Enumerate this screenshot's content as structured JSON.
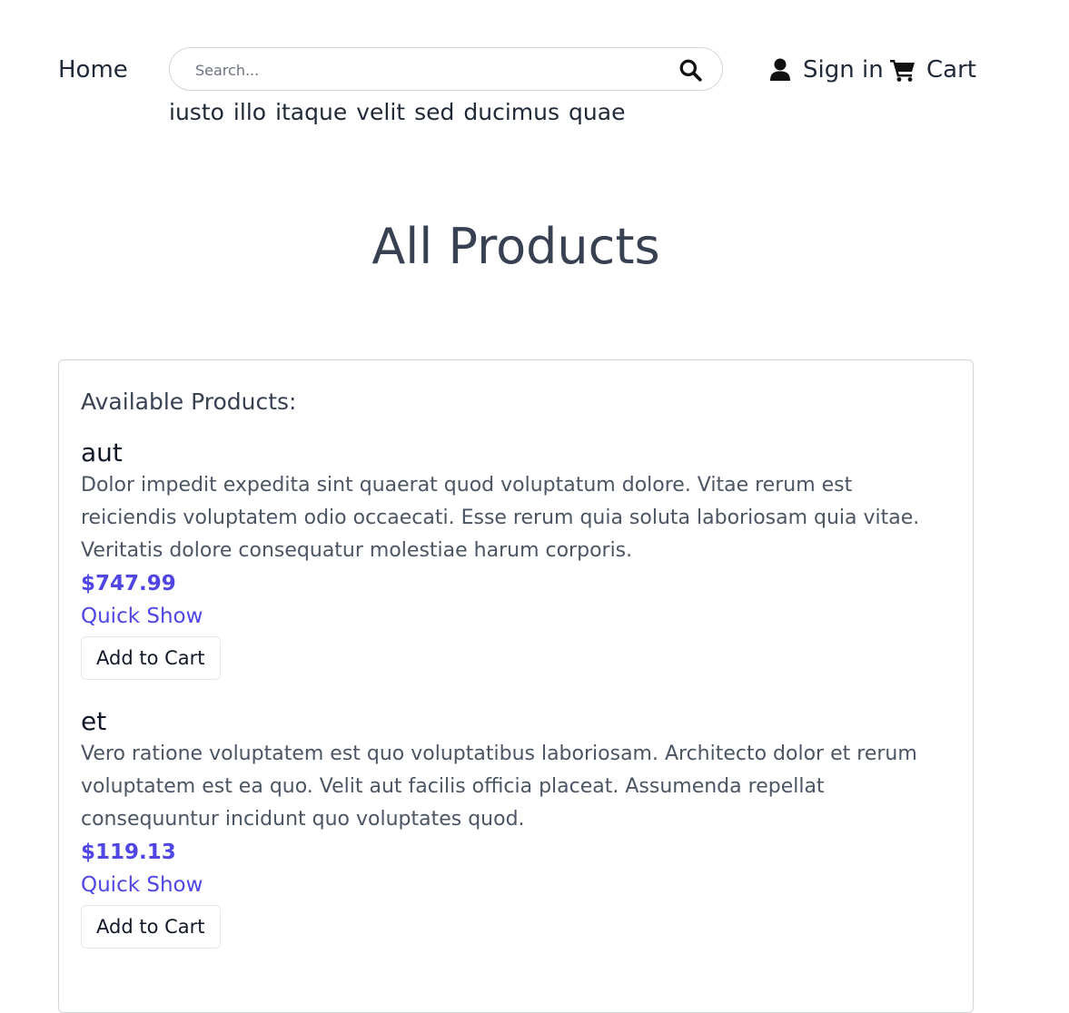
{
  "header": {
    "home_label": "Home",
    "search_placeholder": "Search...",
    "sign_in_label": "Sign in",
    "cart_label": "Cart"
  },
  "tags": [
    "iusto",
    "illo",
    "itaque",
    "velit",
    "sed",
    "ducimus",
    "quae"
  ],
  "page_title": "All Products",
  "panel": {
    "heading": "Available Products:",
    "products": [
      {
        "name": "aut",
        "description": "Dolor impedit expedita sint quaerat quod voluptatum dolore. Vitae rerum est reiciendis voluptatem odio occaecati. Esse rerum quia soluta laboriosam quia vitae. Veritatis dolore consequatur molestiae harum corporis.",
        "price": "$747.99",
        "quick_show_label": "Quick Show",
        "add_to_cart_label": "Add to Cart"
      },
      {
        "name": "et",
        "description": "Vero ratione voluptatem est quo voluptatibus laboriosam. Architecto dolor et rerum voluptatem est ea quo. Velit aut facilis officia placeat. Assumenda repellat consequuntur incidunt quo voluptates quod.",
        "price": "$119.13",
        "quick_show_label": "Quick Show",
        "add_to_cart_label": "Add to Cart"
      }
    ]
  },
  "colors": {
    "accent": "#4f46e5",
    "text": "#374151",
    "border": "#d1d5db"
  },
  "icons": {
    "search": "search-icon",
    "user": "user-icon",
    "cart": "cart-icon"
  }
}
